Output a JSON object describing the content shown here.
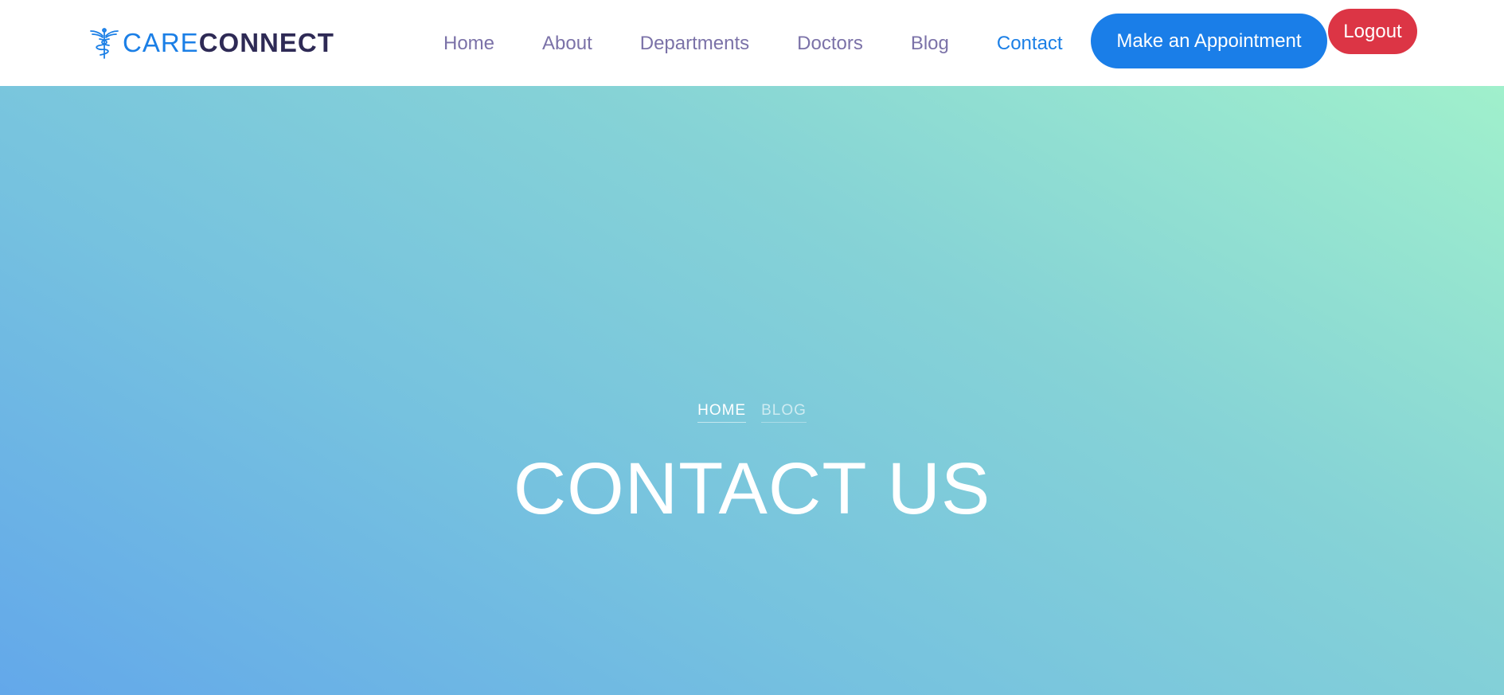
{
  "brand": {
    "name_part1": "CARE",
    "name_part2": "CONNECT",
    "icon": "caduceus-icon"
  },
  "nav": {
    "items": [
      {
        "label": "Home",
        "active": false
      },
      {
        "label": "About",
        "active": false
      },
      {
        "label": "Departments",
        "active": false
      },
      {
        "label": "Doctors",
        "active": false
      },
      {
        "label": "Blog",
        "active": false
      },
      {
        "label": "Contact",
        "active": true
      }
    ],
    "appointment_label": "Make an Appointment",
    "logout_label": "Logout"
  },
  "hero": {
    "breadcrumb": {
      "home": "HOME",
      "current": "BLOG"
    },
    "title": "CONTACT US"
  },
  "colors": {
    "primary": "#1a7ee8",
    "brand_dark": "#2e2a55",
    "nav_text": "#7b72a8",
    "logout": "#dc3545",
    "gradient_start": "#63a8ea",
    "gradient_end": "#a0f0cc"
  }
}
